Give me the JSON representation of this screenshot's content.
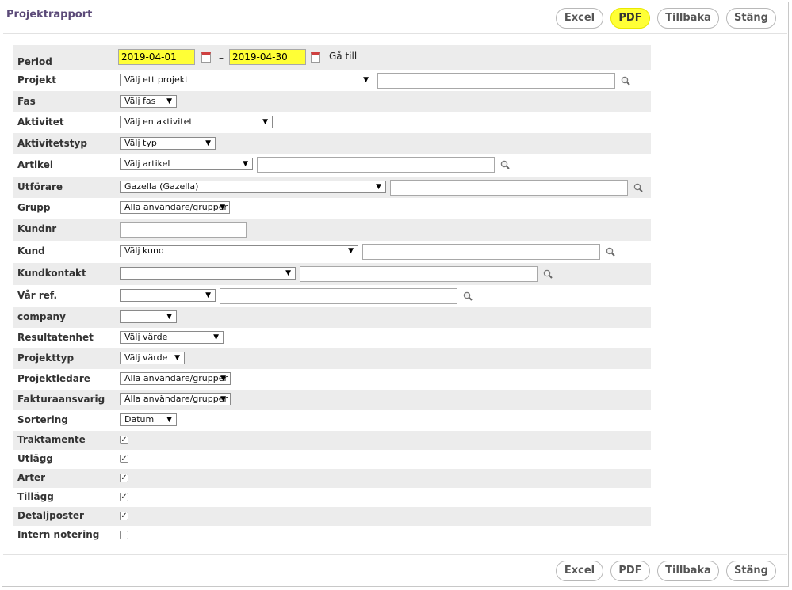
{
  "title": "Projektrapport",
  "buttons": {
    "excel": "Excel",
    "pdf": "PDF",
    "back": "Tillbaka",
    "close": "Stäng"
  },
  "period": {
    "label": "Period",
    "from": "2019-04-01",
    "dash": "–",
    "to": "2019-04-30",
    "goto": "Gå till"
  },
  "fields": {
    "projekt": {
      "label": "Projekt",
      "value": "Välj ett projekt"
    },
    "fas": {
      "label": "Fas",
      "value": "Välj fas"
    },
    "aktivitet": {
      "label": "Aktivitet",
      "value": "Välj en aktivitet"
    },
    "aktivitetstyp": {
      "label": "Aktivitetstyp",
      "value": "Välj typ"
    },
    "artikel": {
      "label": "Artikel",
      "value": "Välj artikel"
    },
    "utforare": {
      "label": "Utförare",
      "value": "Gazella (Gazella)"
    },
    "grupp": {
      "label": "Grupp",
      "value": "Alla användare/grupper"
    },
    "kundnr": {
      "label": "Kundnr"
    },
    "kund": {
      "label": "Kund",
      "value": "Välj kund"
    },
    "kundkontakt": {
      "label": "Kundkontakt",
      "value": ""
    },
    "var_ref": {
      "label": "Vår ref.",
      "value": ""
    },
    "company": {
      "label": "company",
      "value": ""
    },
    "resultatenhet": {
      "label": "Resultatenhet",
      "value": "Välj värde"
    },
    "projekttyp": {
      "label": "Projekttyp",
      "value": "Välj värde"
    },
    "projektledare": {
      "label": "Projektledare",
      "value": "Alla användare/grupper"
    },
    "fakturaansvarig": {
      "label": "Fakturaansvarig",
      "value": "Alla användare/grupper"
    },
    "sortering": {
      "label": "Sortering",
      "value": "Datum"
    }
  },
  "checks": {
    "traktamente": {
      "label": "Traktamente",
      "checked": true
    },
    "utlagg": {
      "label": "Utlägg",
      "checked": true
    },
    "arter": {
      "label": "Arter",
      "checked": true
    },
    "tillagg": {
      "label": "Tillägg",
      "checked": true
    },
    "detaljposter": {
      "label": "Detaljposter",
      "checked": true
    },
    "intern": {
      "label": "Intern notering",
      "checked": false
    }
  },
  "colors": {
    "highlight": "#ffff36",
    "title": "#5b4a78",
    "row_alt": "#ececec"
  }
}
